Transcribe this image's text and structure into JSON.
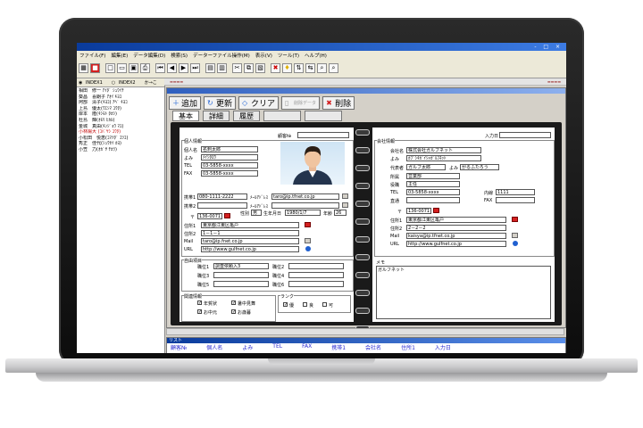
{
  "window": {
    "controls": "- □ ×"
  },
  "menubar": [
    "ファイル(F)",
    "編集(E)",
    "データ編集(D)",
    "検索(S)",
    "データーファイル操作(M)",
    "表示(V)",
    "ツール(T)",
    "ヘルプ(H)"
  ],
  "index_tabs": {
    "index1": "INDEX1",
    "index2": "INDEX2",
    "other": "か→こ"
  },
  "names_list": [
    "相田　修一 ｱｲﾀﾞ ｼｭｳｲﾁ",
    "葵昌　喜朗子 ｱｵｲ ｷﾖｺ",
    "阿部　清子(ｷﾖｺ) ｱﾍﾞ ｷﾖｺ",
    "上島　優太(ｳｴｼﾏ ﾕｳﾀ)",
    "岸本　隆(ｷｼﾓﾄ ﾀｶｼ)",
    "杜島　輝(ｵﾓﾘ ﾋｶﾙ)",
    "金城　真由(ｷﾝｼﾞｮｳ ﾏﾕ)",
    "小林陽大 (ｺﾊﾞﾔｼ ﾕｳﾀ)",
    "小松田　悦恵(ｺﾏﾂﾀﾞ ｴﾂｴ)",
    "秀正　佳代(ｼｭｳｾｲ ｶﾖ)",
    "小笠　力(ｵｶﾞｻ ﾁｶﾗ)"
  ],
  "action_buttons": [
    "追加",
    "更新",
    "クリア",
    "削除"
  ],
  "action_disabled": "削除データ",
  "tabs": [
    "基本",
    "詳細",
    "履歴"
  ],
  "personal": {
    "section": "個人情報",
    "id_label": "顧客№",
    "name_label": "個人名",
    "name": "名刺太郎",
    "yomi_label": "よみ",
    "yomi": "ﾒｲｼﾀﾛｳ",
    "tel_label": "TEL",
    "tel": "03-5858-xxxx",
    "fax_label": "FAX",
    "fax": "03-5858-xxxx",
    "mobile1_label": "携帯1",
    "mobile1": "080-1111-2222",
    "mobile2_label": "携帯2",
    "mail_addr1_label": "ﾒｰﾙｱﾄﾞﾚｽ",
    "mail_addr1": "taro@ip.tfnet.co.jp",
    "mail_addr2_label": "ﾒｰﾙｱﾄﾞﾚｽ",
    "zip_label": "〒",
    "zip": "136-0071",
    "gender_label": "性別",
    "gender": "男",
    "birthday_label": "生年月日",
    "birthday": "1980/1/7",
    "age_label": "年齢",
    "age": "26",
    "addr1_label": "住所1",
    "addr1": "東京都江東区亀戸",
    "addr2_label": "住所2",
    "addr2": "1－1－1",
    "mail_label": "Mail",
    "mail": "taro@ip.fnet.co.jp",
    "url_label": "URL",
    "url": "http://www.gulfnet.co.jp"
  },
  "free_items": {
    "section": "自由項目",
    "labels": [
      "職位1",
      "職位2",
      "職位3",
      "職位4",
      "職位5",
      "職位6"
    ],
    "value1": "調査依頼入3"
  },
  "contact": {
    "section": "関連情報",
    "items": [
      {
        "label": "年賀状",
        "checked": true
      },
      {
        "label": "暑中見舞",
        "checked": true
      },
      {
        "label": "お中元",
        "checked": true
      },
      {
        "label": "お歳暮",
        "checked": true
      }
    ],
    "rank_section": "ランク",
    "ranks": [
      {
        "label": "優",
        "checked": true
      },
      {
        "label": "良",
        "checked": false
      },
      {
        "label": "可",
        "checked": false
      }
    ]
  },
  "company": {
    "input_date_label": "入力日",
    "section": "会社情報",
    "name_label": "会社名",
    "name": "株式会社ガルフネット",
    "yomi_label": "よみ",
    "yomi": "ｶﾌﾞｼｷｶﾞｲｼｬｶﾞﾙﾌﾈｯﾄ",
    "rep_label": "代表者",
    "rep": "ガルフ太郎",
    "rep_yomi_label": "よみ",
    "rep_yomi": "がるふたろう",
    "dept_label": "所属",
    "dept": "営業部",
    "title_label": "役職",
    "title": "主任",
    "tel_label": "TEL",
    "tel": "03-5858-xxxx",
    "ext_label": "内線",
    "ext": "1111",
    "direct_label": "直通",
    "fax_label": "FAX",
    "zip_label": "〒",
    "zip": "136-0071",
    "addr1_label": "住所1",
    "addr1": "東京都江東区亀戸",
    "addr2_label": "住所2",
    "addr2": "2－2－2",
    "mail_label": "Mail",
    "mail": "kaisya@ip.tfnet.co.jp",
    "url_label": "URL",
    "url": "http://www.gulfnet.co.jp",
    "memo_label": "メモ",
    "memo": "ガルフネット"
  },
  "list_window": {
    "title": "リスト",
    "headers": [
      "顧客№",
      "個人名",
      "よみ",
      "TEL",
      "FAX",
      "携帯1",
      "会社名",
      "住所1",
      "入力日"
    ]
  },
  "colors": {
    "titlebar": "#0a3b9c",
    "accent_red": "#d42020"
  }
}
